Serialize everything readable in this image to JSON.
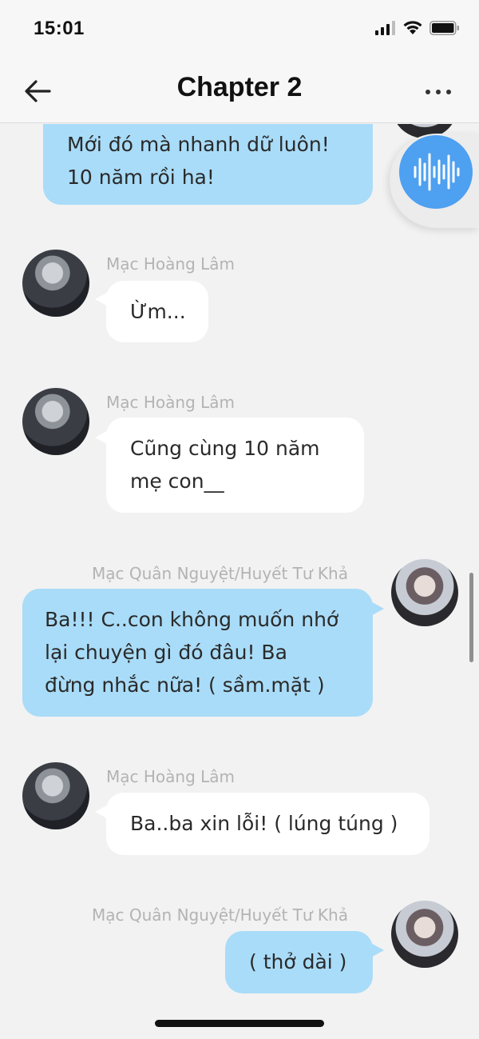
{
  "status_bar": {
    "time": "15:01"
  },
  "header": {
    "title": "Chapter 2"
  },
  "messages": [
    {
      "lines": [
        "Mới đó mà nhanh dữ luôn!",
        "10 năm rồi ha!"
      ]
    },
    {
      "sender": "Mạc Hoàng Lâm",
      "lines": [
        "Ừm..."
      ]
    },
    {
      "sender": "Mạc Hoàng Lâm",
      "lines": [
        "Cũng cùng 10 năm",
        "mẹ con__"
      ]
    },
    {
      "sender": "Mạc Quân Nguyệt/Huyết Tư Khả",
      "lines": [
        "Ba!!! C..con không muốn nhớ",
        "lại chuyện gì đó đâu! Ba",
        "đừng nhắc nữa! ( sầm.mặt )"
      ]
    },
    {
      "sender": "Mạc Hoàng Lâm",
      "lines": [
        "Ba..ba xin lỗi! ( lúng túng )"
      ]
    },
    {
      "sender": "Mạc Quân Nguyệt/Huyết Tư Khả",
      "lines": [
        "( thở dài )"
      ]
    }
  ],
  "colors": {
    "bubble_outgoing": "#a9dcf8",
    "bubble_incoming": "#ffffff",
    "voice_button": "#4ea0f0"
  },
  "icons": {
    "back": "arrow-left-icon",
    "more": "more-horizontal-icon",
    "voice": "voice-wave-icon"
  }
}
